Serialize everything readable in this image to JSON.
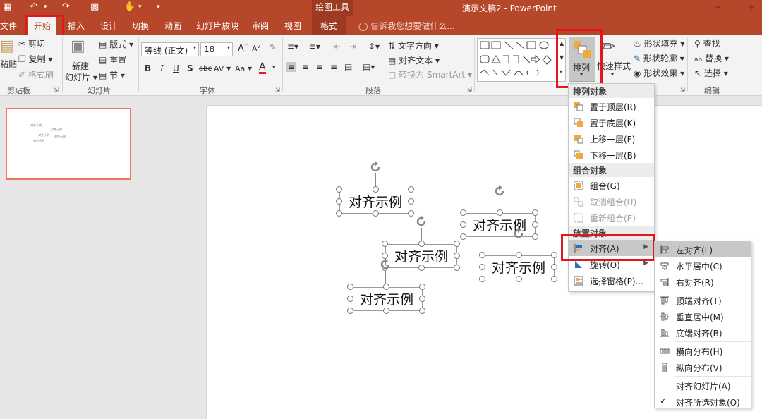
{
  "titlebar": {
    "context_tools": "绘图工具",
    "document_title": "演示文稿2 - PowerPoint"
  },
  "tabs": [
    "文件",
    "开始",
    "插入",
    "设计",
    "切换",
    "动画",
    "幻灯片放映",
    "审阅",
    "视图",
    "格式"
  ],
  "active_tab": "开始",
  "tell_me": "告诉我您想要做什么...",
  "ribbon": {
    "clipboard": {
      "paste": "粘贴",
      "cut": "剪切",
      "copy": "复制",
      "format_painter": "格式刷",
      "group": "剪贴板"
    },
    "slides": {
      "new_slide_1": "新建",
      "new_slide_2": "幻灯片",
      "layout": "版式",
      "reset": "重置",
      "section": "节",
      "group": "幻灯片"
    },
    "font": {
      "name": "等线 (正文)",
      "size": "18",
      "grow": "A",
      "shrink": "A",
      "bold": "B",
      "italic": "I",
      "underline": "U",
      "shadow": "S",
      "strike": "abc",
      "spacing": "AV",
      "case": "Aa",
      "color": "A",
      "group": "字体"
    },
    "paragraph": {
      "text_direction": "文字方向",
      "align_text": "对齐文本",
      "smartart": "转换为 SmartArt",
      "group": "段落"
    },
    "drawing": {
      "arrange": "排列",
      "quick_styles": "快速样式",
      "shape_fill": "形状填充",
      "shape_outline": "形状轮廓",
      "shape_effects": "形状效果"
    },
    "editing": {
      "find": "查找",
      "replace": "替换",
      "select": "选择",
      "group": "编辑"
    }
  },
  "slide": {
    "textboxes": [
      "对齐示例",
      "对齐示例",
      "对齐示例",
      "对齐示例",
      "对齐示例"
    ]
  },
  "thumbnail": {
    "labels": [
      "对齐示例",
      "对齐示例",
      "对齐示例",
      "对齐示例",
      "对齐示例"
    ]
  },
  "arrange_menu": {
    "header_order": "排列对象",
    "bring_front": "置于顶层(R)",
    "send_back": "置于底层(K)",
    "forward": "上移一层(F)",
    "backward": "下移一层(B)",
    "header_group": "组合对象",
    "group": "组合(G)",
    "ungroup": "取消组合(U)",
    "regroup": "重新组合(E)",
    "header_position": "放置对象",
    "align": "对齐(A)",
    "rotate": "旋转(O)",
    "selection_pane": "选择窗格(P)..."
  },
  "align_menu": {
    "align_left": "左对齐(L)",
    "align_center": "水平居中(C)",
    "align_right": "右对齐(R)",
    "align_top": "顶端对齐(T)",
    "align_middle": "垂直居中(M)",
    "align_bottom": "底端对齐(B)",
    "distribute_h": "横向分布(H)",
    "distribute_v": "纵向分布(V)",
    "align_slide": "对齐幻灯片(A)",
    "align_selected": "对齐所选对象(O)"
  },
  "colors": {
    "brand": "#b7472a",
    "highlight_box": "#e8141c"
  }
}
